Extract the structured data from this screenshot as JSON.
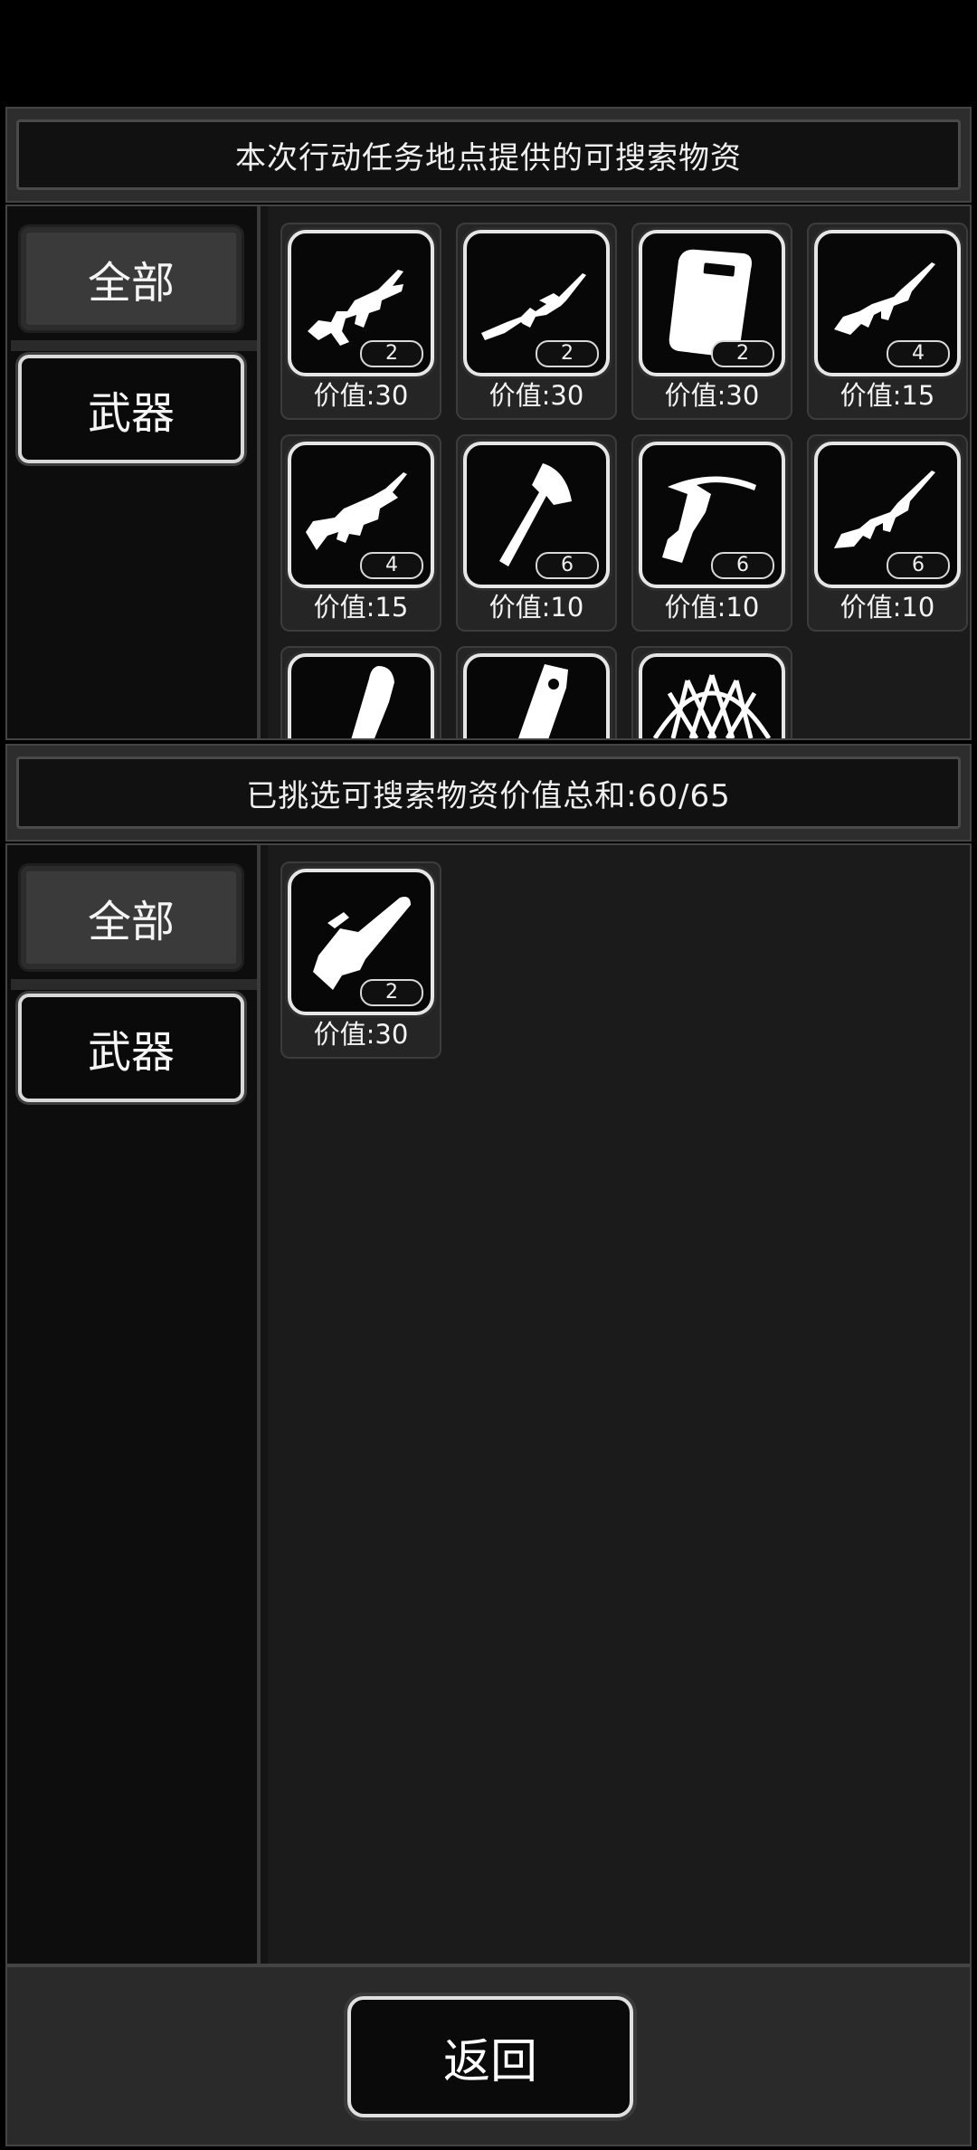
{
  "header": {
    "title": "本次行动任务地点提供的可搜索物资"
  },
  "available": {
    "tabs": [
      {
        "label": "全部"
      },
      {
        "label": "武器"
      }
    ],
    "items": [
      {
        "icon": "assault-rifle-icon",
        "count": "2",
        "price": "价值:30"
      },
      {
        "icon": "sniper-rifle-icon",
        "count": "2",
        "price": "价值:30"
      },
      {
        "icon": "riot-shield-icon",
        "count": "2",
        "price": "价值:30"
      },
      {
        "icon": "rifle-icon",
        "count": "4",
        "price": "价值:15"
      },
      {
        "icon": "bullpup-rifle-icon",
        "count": "4",
        "price": "价值:15"
      },
      {
        "icon": "axe-icon",
        "count": "6",
        "price": "价值:10"
      },
      {
        "icon": "crossbow-icon",
        "count": "6",
        "price": "价值:10"
      },
      {
        "icon": "m16-rifle-icon",
        "count": "6",
        "price": "价值:10"
      },
      {
        "icon": "chainsaw-icon",
        "count": "",
        "price": ""
      },
      {
        "icon": "grenade-icon",
        "count": "",
        "price": ""
      },
      {
        "icon": "net-icon",
        "count": "",
        "price": ""
      }
    ]
  },
  "selected": {
    "summary": "已挑选可搜索物资价值总和:60/65",
    "tabs": [
      {
        "label": "全部"
      },
      {
        "label": "武器"
      }
    ],
    "items": [
      {
        "icon": "chainsaw-icon",
        "count": "2",
        "price": "价值:30"
      }
    ]
  },
  "footer": {
    "back_label": "返回"
  },
  "colors": {
    "background": "#000000",
    "panel": "#141414",
    "border": "#e6e6e6",
    "text": "#f2f2f2"
  }
}
